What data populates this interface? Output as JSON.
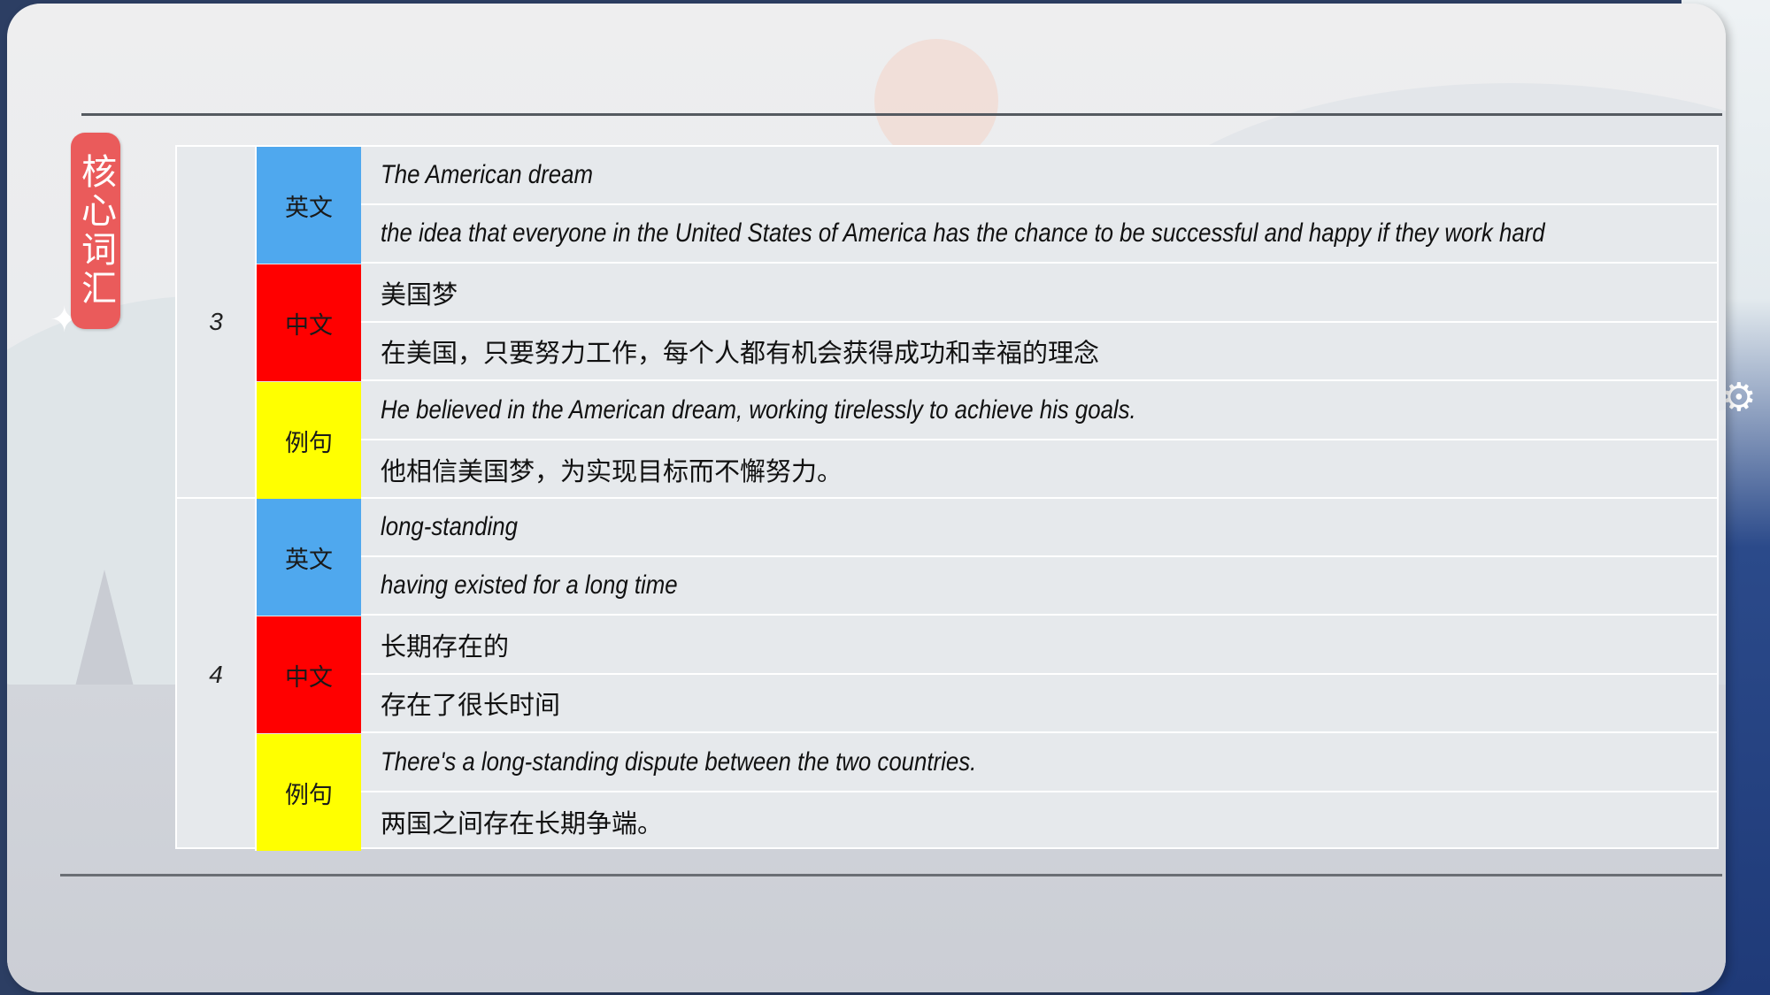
{
  "side_badge": {
    "label": "核心词汇"
  },
  "entries": [
    {
      "number": "3",
      "english": {
        "tag": "英文",
        "term": "The American dream",
        "definition": "the idea that everyone in the United States of America has the chance to be successful and happy if they work hard"
      },
      "chinese": {
        "tag": "中文",
        "term": "美国梦",
        "definition": "在美国，只要努力工作，每个人都有机会获得成功和幸福的理念"
      },
      "example": {
        "tag": "例句",
        "sentence_en": "He believed in the American dream, working tirelessly to achieve his goals.",
        "sentence_zh": "他相信美国梦，为实现目标而不懈努力。"
      }
    },
    {
      "number": "4",
      "english": {
        "tag": "英文",
        "term": "long-standing",
        "definition": "having existed for a long time"
      },
      "chinese": {
        "tag": "中文",
        "term": "长期存在的",
        "definition": "存在了很长时间"
      },
      "example": {
        "tag": "例句",
        "sentence_en": "There's a long-standing dispute between the two countries.",
        "sentence_zh": "两国之间存在长期争端。"
      }
    }
  ],
  "colors": {
    "english_tag": "#4fa8ee",
    "chinese_tag": "#ff0000",
    "example_tag": "#ffff00",
    "badge": "#ea5b5b"
  },
  "icons": {
    "decor": "gear-icon"
  }
}
